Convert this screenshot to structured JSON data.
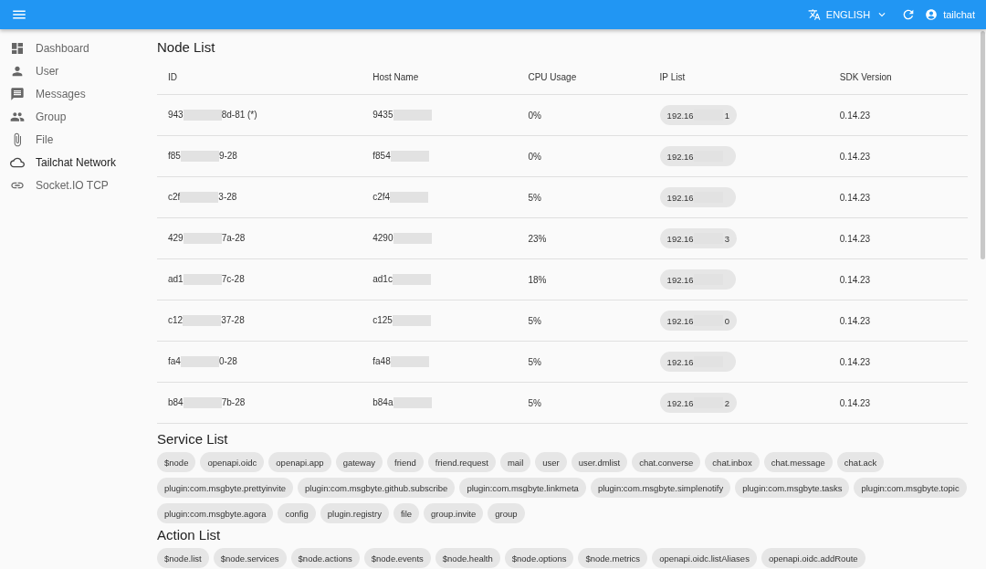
{
  "top_bar": {
    "language": "ENGLISH",
    "user": "tailchat"
  },
  "sidebar": {
    "items": [
      {
        "label": "Dashboard",
        "selected": false
      },
      {
        "label": "User",
        "selected": false
      },
      {
        "label": "Messages",
        "selected": false
      },
      {
        "label": "Group",
        "selected": false
      },
      {
        "label": "File",
        "selected": false
      },
      {
        "label": "Tailchat Network",
        "selected": true
      },
      {
        "label": "Socket.IO TCP",
        "selected": false
      }
    ]
  },
  "node_list": {
    "title": "Node List",
    "columns": [
      "ID",
      "Host Name",
      "CPU Usage",
      "IP List",
      "SDK Version"
    ],
    "rows": [
      {
        "id_head": "943",
        "id_tail": "8d-81 (*)",
        "host": "9435",
        "cpu": "0%",
        "ip_head": "192.16",
        "ip_tail": "1",
        "sdk": "0.14.23"
      },
      {
        "id_head": "f85",
        "id_tail": "9-28",
        "host": "f854",
        "cpu": "0%",
        "ip_head": "192.16",
        "ip_tail": "",
        "sdk": "0.14.23"
      },
      {
        "id_head": "c2f",
        "id_tail": "3-28",
        "host": "c2f4",
        "cpu": "5%",
        "ip_head": "192.16",
        "ip_tail": "",
        "sdk": "0.14.23"
      },
      {
        "id_head": "429",
        "id_tail": "7a-28",
        "host": "4290",
        "cpu": "23%",
        "ip_head": "192.16",
        "ip_tail": "3",
        "sdk": "0.14.23"
      },
      {
        "id_head": "ad1",
        "id_tail": "7c-28",
        "host": "ad1c",
        "cpu": "18%",
        "ip_head": "192.16",
        "ip_tail": "",
        "sdk": "0.14.23"
      },
      {
        "id_head": "c12",
        "id_tail": "37-28",
        "host": "c125",
        "cpu": "5%",
        "ip_head": "192.16",
        "ip_tail": "0",
        "sdk": "0.14.23"
      },
      {
        "id_head": "fa4",
        "id_tail": "0-28",
        "host": "fa48",
        "cpu": "5%",
        "ip_head": "192.16",
        "ip_tail": "",
        "sdk": "0.14.23"
      },
      {
        "id_head": "b84",
        "id_tail": "7b-28",
        "host": "b84a",
        "cpu": "5%",
        "ip_head": "192.16",
        "ip_tail": "2",
        "sdk": "0.14.23"
      }
    ]
  },
  "service_list": {
    "title": "Service List",
    "items": [
      "$node",
      "openapi.oidc",
      "openapi.app",
      "gateway",
      "friend",
      "friend.request",
      "mail",
      "user",
      "user.dmlist",
      "chat.converse",
      "chat.inbox",
      "chat.message",
      "chat.ack",
      "plugin:com.msgbyte.prettyinvite",
      "plugin:com.msgbyte.github.subscribe",
      "plugin:com.msgbyte.linkmeta",
      "plugin:com.msgbyte.simplenotify",
      "plugin:com.msgbyte.tasks",
      "plugin:com.msgbyte.topic",
      "plugin:com.msgbyte.agora",
      "config",
      "plugin.registry",
      "file",
      "group.invite",
      "group"
    ]
  },
  "action_list": {
    "title": "Action List",
    "items": [
      "$node.list",
      "$node.services",
      "$node.actions",
      "$node.events",
      "$node.health",
      "$node.options",
      "$node.metrics",
      "openapi.oidc.listAliases",
      "openapi.oidc.addRoute"
    ]
  }
}
